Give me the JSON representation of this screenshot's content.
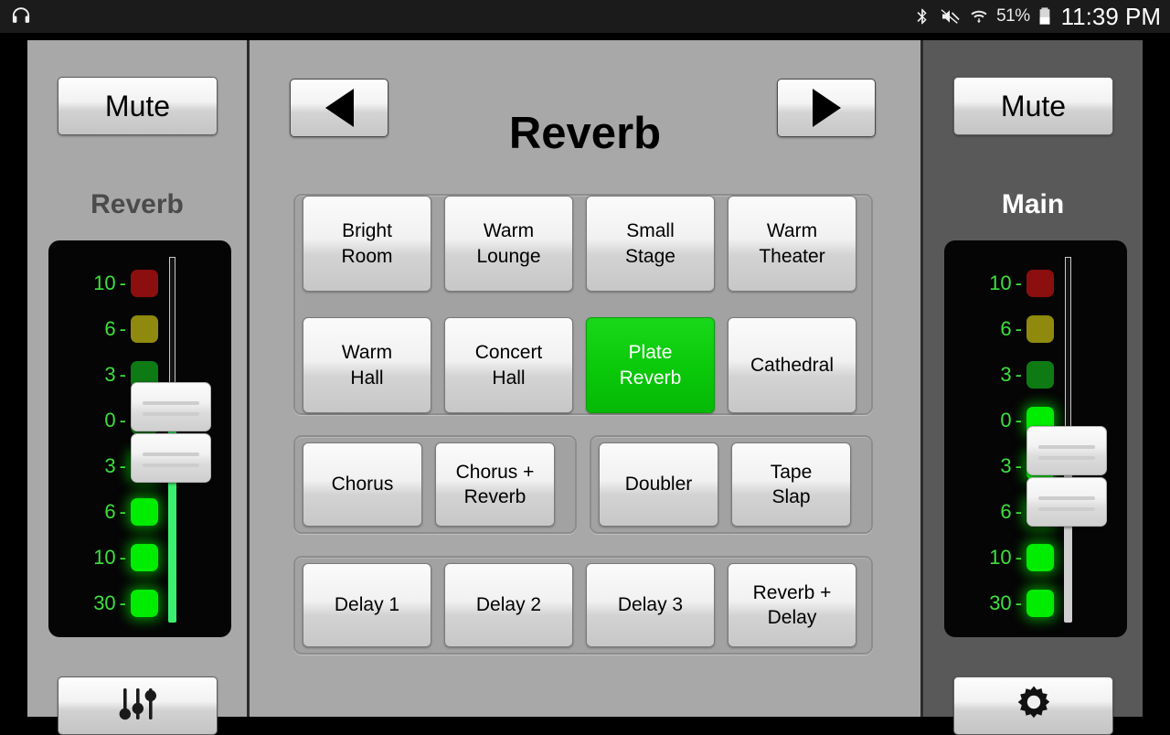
{
  "statusbar": {
    "app_icon": "headphones-icon",
    "bluetooth_icon": "bluetooth-icon",
    "volume_muted_icon": "volume-mute-icon",
    "wifi_icon": "wifi-icon",
    "battery_percent": "51%",
    "battery_icon": "battery-icon",
    "clock": "11:39 PM"
  },
  "left_strip": {
    "mute_label": "Mute",
    "title": "Reverb",
    "settings_icon": "sliders-icon",
    "meter": {
      "labels": [
        "10",
        "6",
        "3",
        "0",
        "3",
        "6",
        "10",
        "30"
      ],
      "colors": [
        "#8b0f0f",
        "#8f8a0e",
        "#0d7a14",
        "#0d7a14",
        "#00ec00",
        "#00ec00",
        "#00ec00",
        "#00ec00"
      ],
      "lit": [
        false,
        false,
        false,
        false,
        true,
        true,
        true,
        true
      ]
    },
    "fader": {
      "handle_a_percent": 41,
      "handle_b_percent": 55,
      "track_color": "#3bf06e"
    }
  },
  "right_strip": {
    "mute_label": "Mute",
    "title": "Main",
    "settings_icon": "gear-icon",
    "meter": {
      "labels": [
        "10",
        "6",
        "3",
        "0",
        "3",
        "6",
        "10",
        "30"
      ],
      "colors": [
        "#8b0f0f",
        "#8f8a0e",
        "#0d7a14",
        "#00ec00",
        "#00ec00",
        "#00ec00",
        "#00ec00",
        "#00ec00"
      ],
      "lit": [
        false,
        false,
        false,
        true,
        true,
        true,
        true,
        true
      ]
    },
    "fader": {
      "handle_a_percent": 53,
      "handle_b_percent": 67,
      "track_color": "#cfcfcf"
    }
  },
  "center": {
    "title": "Reverb",
    "prev_icon": "triangle-left-icon",
    "next_icon": "triangle-right-icon",
    "groups": [
      {
        "name": "reverb-presets",
        "buttons": [
          {
            "label": "Bright\nRoom",
            "active": false
          },
          {
            "label": "Warm\nLounge",
            "active": false
          },
          {
            "label": "Small\nStage",
            "active": false
          },
          {
            "label": "Warm\nTheater",
            "active": false
          },
          {
            "label": "Warm\nHall",
            "active": false
          },
          {
            "label": "Concert\nHall",
            "active": false
          },
          {
            "label": "Plate\nReverb",
            "active": true
          },
          {
            "label": "Cathedral",
            "active": false
          }
        ]
      },
      {
        "name": "chorus-presets",
        "buttons": [
          {
            "label": "Chorus",
            "active": false
          },
          {
            "label": "Chorus +\nReverb",
            "active": false
          }
        ]
      },
      {
        "name": "doubler-presets",
        "buttons": [
          {
            "label": "Doubler",
            "active": false
          },
          {
            "label": "Tape\nSlap",
            "active": false
          }
        ]
      },
      {
        "name": "delay-presets",
        "buttons": [
          {
            "label": "Delay 1",
            "active": false
          },
          {
            "label": "Delay 2",
            "active": false
          },
          {
            "label": "Delay 3",
            "active": false
          },
          {
            "label": "Reverb +\nDelay",
            "active": false
          }
        ]
      }
    ]
  },
  "colors": {
    "accent_green": "#0ac80a",
    "panel_light": "#a8a8a8",
    "panel_dark": "#595959",
    "meter_bg": "#050505",
    "led_green": "#00ec00"
  }
}
